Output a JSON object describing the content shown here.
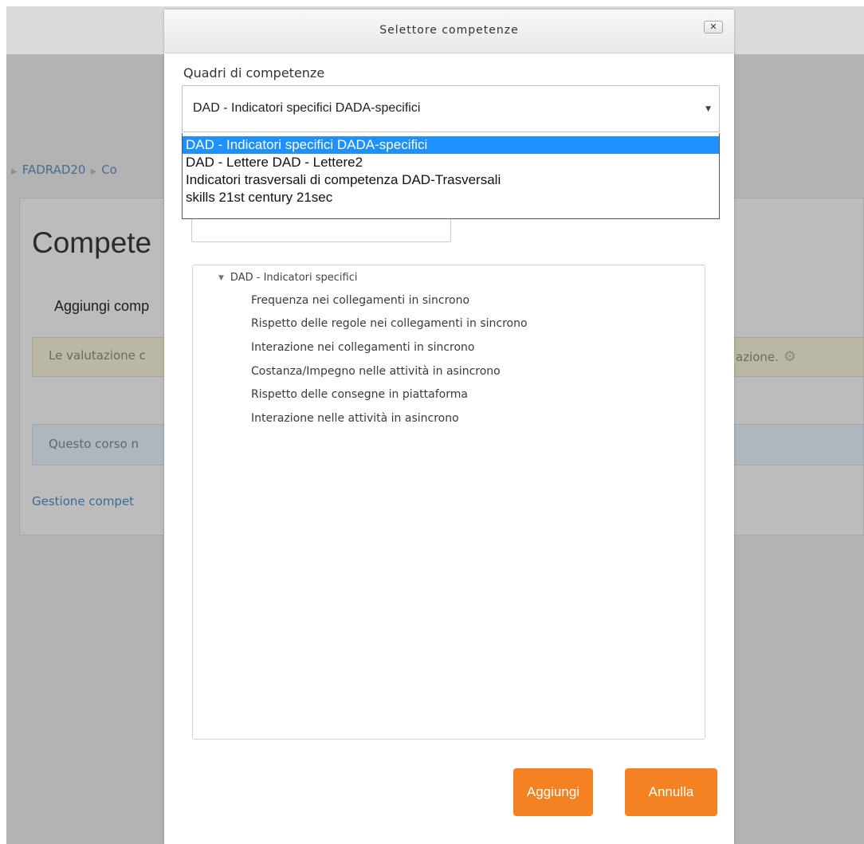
{
  "background": {
    "breadcrumb": [
      "FADRAD20",
      "Co"
    ],
    "heading": "Compete",
    "add_link": "Aggiungi comp",
    "warning_left": "Le valutazione c",
    "warning_right": "azione.",
    "info_text": "Questo corso n",
    "manage_link": "Gestione compet"
  },
  "modal": {
    "title": "Selettore competenze",
    "close_label": "x",
    "framework_label": "Quadri di competenze",
    "framework_selected": "DAD - Indicatori specifici DADA-specifici",
    "framework_options": [
      "DAD - Indicatori specifici DADA-specifici",
      "DAD - Lettere DAD - Lettere2",
      "Indicatori trasversali di competenza DAD-Trasversali",
      "skills 21st century 21sec"
    ],
    "tree": {
      "root": "DAD - Indicatori specifici",
      "items": [
        "Frequenza nei collegamenti in sincrono",
        "Rispetto delle regole nei collegamenti in sincrono",
        "Interazione nei collegamenti in sincrono",
        "Costanza/Impegno nelle attività in asincrono",
        "Rispetto delle consegne in piattaforma",
        "Interazione nelle attività in asincrono"
      ]
    },
    "add_button": "Aggiungi",
    "cancel_button": "Annulla"
  },
  "colors": {
    "accent": "#f58220",
    "selection": "#1e90ff",
    "link": "#3b6a95"
  },
  "icons": {
    "close": "close-icon",
    "dropdown": "caret-down-icon",
    "tree_expand": "triangle-down-icon",
    "settings": "gear-icon"
  }
}
